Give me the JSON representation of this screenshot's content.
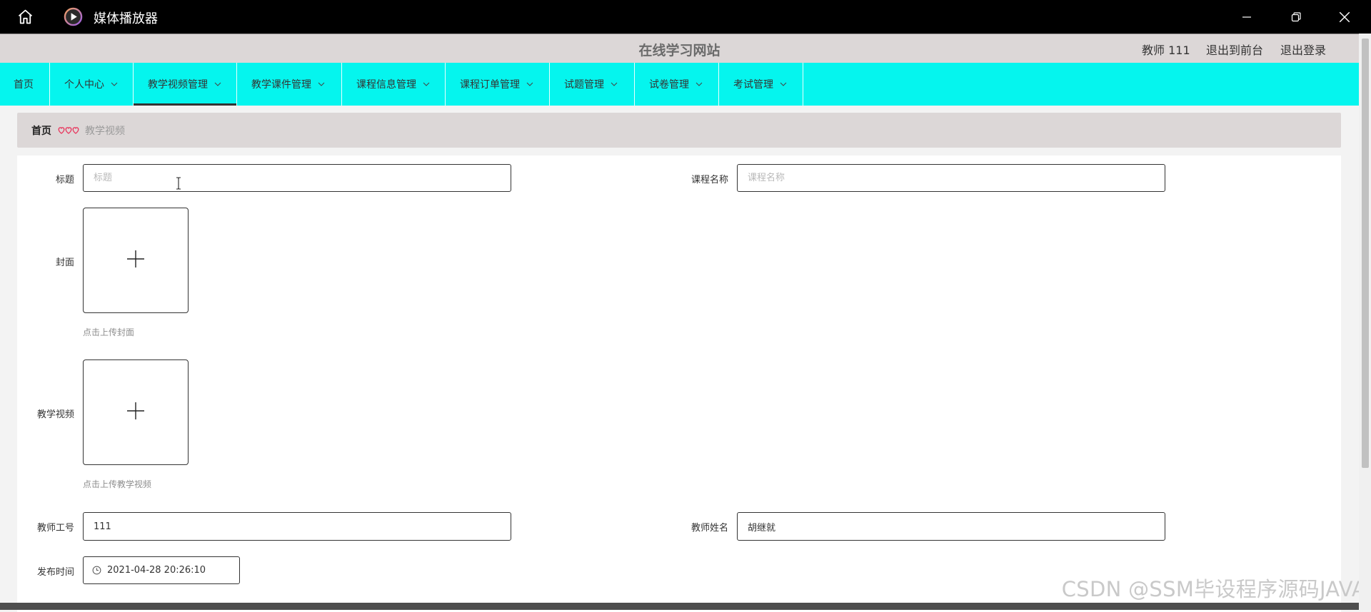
{
  "window": {
    "title": "媒体播放器",
    "home_icon": "home-icon",
    "app_icon": "media-player-icon",
    "controls": [
      "minimize-icon",
      "restore-icon",
      "close-icon"
    ]
  },
  "header": {
    "site_title": "在线学习网站",
    "user_label": "教师 111",
    "to_front": "退出到前台",
    "logout": "退出登录"
  },
  "colors": {
    "titlebar": "#000000",
    "header_bg": "#dcd7d7",
    "nav_bg": "#05f5ee",
    "active_underline": "#333333",
    "breadcrumb_bg": "#dcd7d7",
    "page_bg": "#f3f3f3",
    "separator": "#e8365d"
  },
  "nav": {
    "items": [
      {
        "label": "首页",
        "dropdown": false,
        "active": false
      },
      {
        "label": "个人中心",
        "dropdown": true,
        "active": false
      },
      {
        "label": "教学视频管理",
        "dropdown": true,
        "active": true
      },
      {
        "label": "教学课件管理",
        "dropdown": true,
        "active": false
      },
      {
        "label": "课程信息管理",
        "dropdown": true,
        "active": false
      },
      {
        "label": "课程订单管理",
        "dropdown": true,
        "active": false
      },
      {
        "label": "试题管理",
        "dropdown": true,
        "active": false
      },
      {
        "label": "试卷管理",
        "dropdown": true,
        "active": false
      },
      {
        "label": "考试管理",
        "dropdown": true,
        "active": false
      }
    ]
  },
  "breadcrumb": {
    "home": "首页",
    "separator_icon": "heart-icon",
    "current": "教学视频"
  },
  "form": {
    "title": {
      "label": "标题",
      "value": "",
      "placeholder": "标题"
    },
    "course_name": {
      "label": "课程名称",
      "value": "",
      "placeholder": "课程名称"
    },
    "cover": {
      "label": "封面",
      "hint": "点击上传封面",
      "icon": "plus-icon"
    },
    "video": {
      "label": "教学视频",
      "hint": "点击上传教学视频",
      "icon": "plus-icon"
    },
    "teacher_id": {
      "label": "教师工号",
      "value": "111"
    },
    "teacher_name": {
      "label": "教师姓名",
      "value": "胡继就"
    },
    "publish_time": {
      "label": "发布时间",
      "value": "2021-04-28 20:26:10",
      "icon": "clock-icon"
    }
  },
  "watermark": "CSDN @SSM毕设程序源码JAVA"
}
